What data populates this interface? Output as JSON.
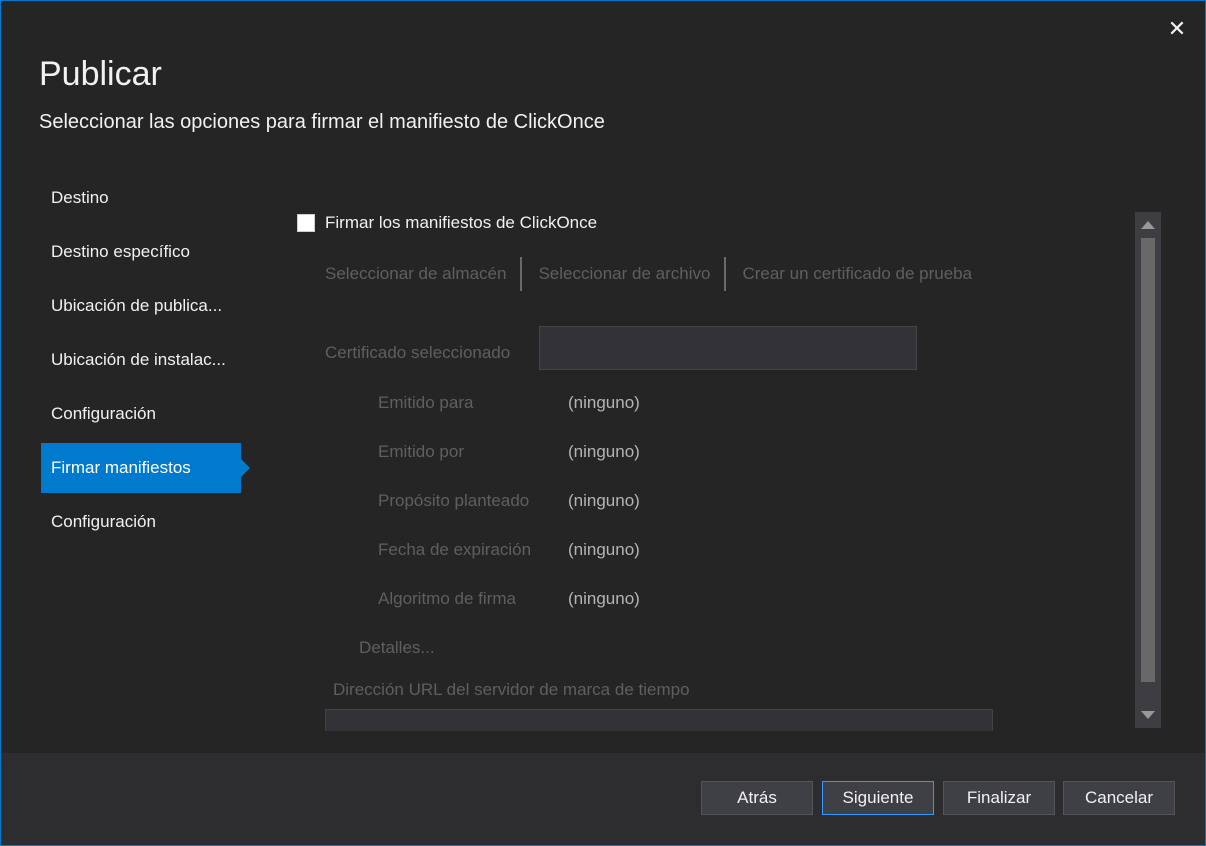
{
  "dialog": {
    "title": "Publicar",
    "subtitle": "Seleccionar las opciones para firmar el manifiesto de ClickOnce",
    "close_icon": "close-icon"
  },
  "nav": {
    "items": [
      {
        "label": "Destino"
      },
      {
        "label": "Destino específico"
      },
      {
        "label": "Ubicación de publica..."
      },
      {
        "label": "Ubicación de instalac..."
      },
      {
        "label": "Configuración"
      },
      {
        "label": "Firmar manifiestos",
        "active": true
      },
      {
        "label": "Configuración"
      }
    ]
  },
  "signing": {
    "checkbox_label": "Firmar los manifiestos de ClickOnce",
    "checked": false,
    "cert_sources": [
      "Seleccionar de almacén",
      "Seleccionar de archivo",
      "Crear un certificado de prueba"
    ],
    "selected_cert_label": "Certificado seleccionado",
    "selected_cert_value": "",
    "details": [
      {
        "label": "Emitido para",
        "value": "(ninguno)"
      },
      {
        "label": "Emitido por",
        "value": "(ninguno)"
      },
      {
        "label": "Propósito planteado",
        "value": "(ninguno)"
      },
      {
        "label": "Fecha de expiración",
        "value": "(ninguno)"
      },
      {
        "label": "Algoritmo de firma",
        "value": "(ninguno)"
      }
    ],
    "details_link": "Detalles...",
    "timestamp_label": "Dirección URL del servidor de marca de tiempo",
    "timestamp_value": ""
  },
  "footer": {
    "back": "Atrás",
    "next": "Siguiente",
    "finish": "Finalizar",
    "cancel": "Cancelar"
  },
  "colors": {
    "accent": "#007acc",
    "background": "#252526",
    "disabled_text": "#5f5f60"
  }
}
